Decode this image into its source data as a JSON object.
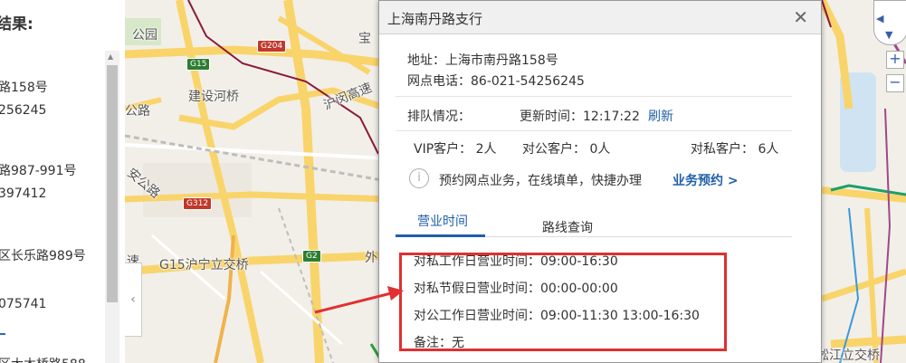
{
  "results_panel": {
    "title": "结果:",
    "lines": [
      "路158号",
      "256245",
      "路987-991号",
      "397412",
      "区长乐路989号",
      "075741",
      "区大木桥路588"
    ]
  },
  "map": {
    "labels": [
      "公园",
      "宝",
      "建设河桥",
      "沪闵高速",
      "公路",
      "安公路",
      "速",
      "G15沪宁立交桥",
      "外",
      "淞江立交桥"
    ],
    "badges": [
      "G15",
      "G204",
      "G312",
      "G2"
    ],
    "colors": {
      "road_yellow": "#f9d46a",
      "road_orange": "#f0b24a",
      "metro_red": "#8b1a3a",
      "metro_purple": "#a0468a",
      "metro_green": "#1aa06a",
      "metro_blue": "#3a9ad9"
    }
  },
  "popup": {
    "title": "上海南丹路支行",
    "close_icon": "close-icon",
    "address": "地址：上海市南丹路158号",
    "phone": "网点电话：86-021-54256245",
    "queue_label": "排队情况：",
    "update_time": "更新时间：12:17:22",
    "refresh": "刷新",
    "vip": "VIP客户： 2人",
    "corporate": "对公客户： 0人",
    "personal": "对私客户： 6人",
    "booking_text": "预约网点业务，在线填单，快捷办理",
    "booking_link": "业务预约 >",
    "tabs": [
      "营业时间",
      "路线查询"
    ],
    "hours": [
      "对私工作日营业时间：09:00-16:30",
      "对私节假日营业时间：00:00-00:00",
      "对公工作日营业时间：09:00-11:30  13:00-16:30",
      "备注：无"
    ]
  },
  "annotation_color": "#e03030",
  "accent_color": "#1f5fa8"
}
